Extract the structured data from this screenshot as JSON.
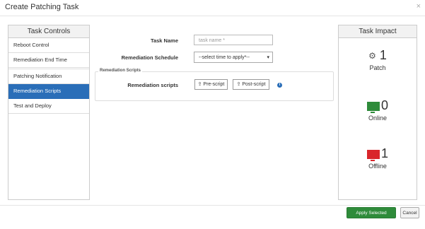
{
  "dialog": {
    "title": "Create Patching Task",
    "close": "×"
  },
  "task_controls": {
    "header": "Task Controls",
    "items": [
      {
        "label": "Reboot Control",
        "active": false
      },
      {
        "label": "Remediation End Time",
        "active": false
      },
      {
        "label": "Patching Notification",
        "active": false
      },
      {
        "label": "Remediation Scripts",
        "active": true
      },
      {
        "label": "Test and Deploy",
        "active": false
      }
    ]
  },
  "form": {
    "task_name_label": "Task Name",
    "task_name_placeholder": "task name *",
    "schedule_label": "Remediation Schedule",
    "schedule_selected": "--select time to apply*--",
    "scripts_legend": "Remediation Scripts",
    "scripts_label": "Remediation scripts",
    "pre_script": "Pre-script",
    "post_script": "Post-script"
  },
  "task_impact": {
    "header": "Task Impact",
    "patch": {
      "count": "1",
      "label": "Patch",
      "icon": "gear-icon"
    },
    "online": {
      "count": "0",
      "label": "Online",
      "icon": "monitor-icon",
      "color": "#2e8b3a"
    },
    "offline": {
      "count": "1",
      "label": "Offline",
      "icon": "monitor-icon",
      "color": "#d9262b"
    }
  },
  "footer": {
    "apply": "Apply Selected Patches",
    "cancel": "Cancel"
  }
}
